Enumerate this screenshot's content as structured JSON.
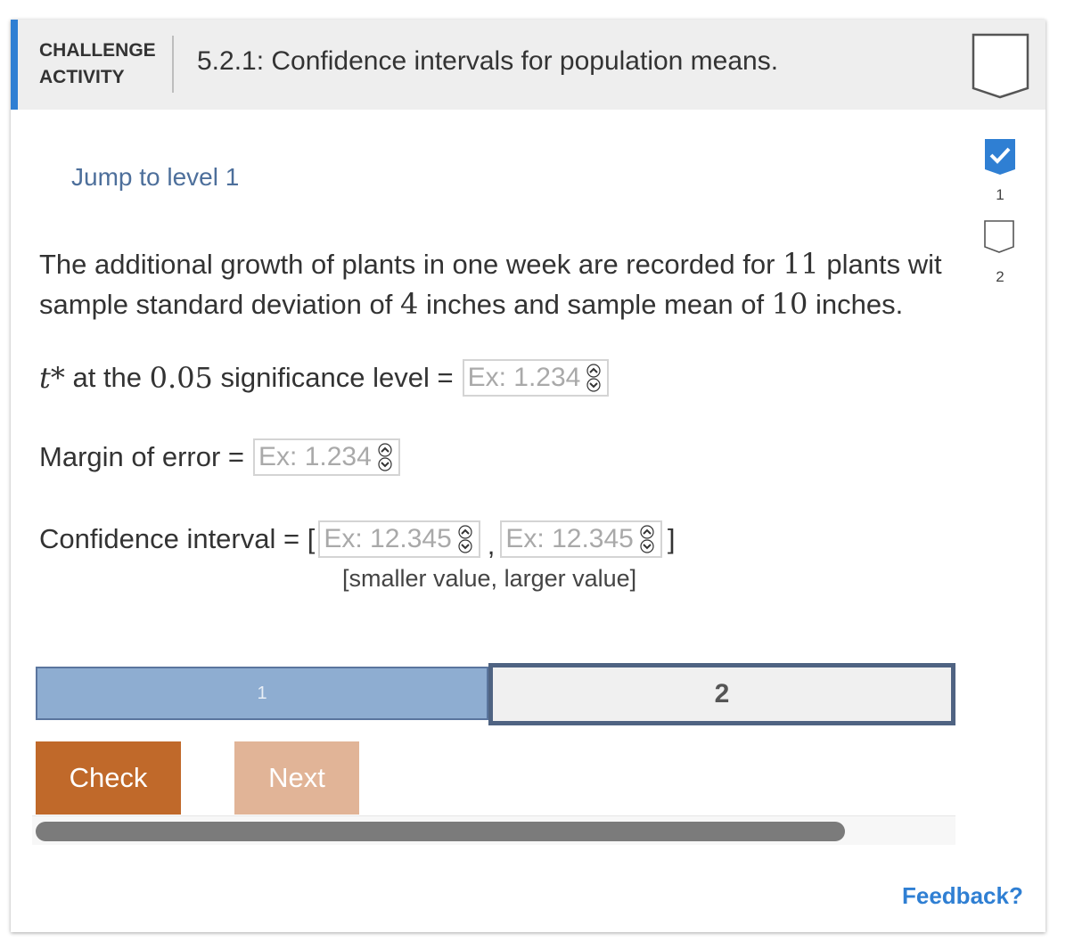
{
  "header": {
    "activity_type_line1": "CHALLENGE",
    "activity_type_line2": "ACTIVITY",
    "title": "5.2.1: Confidence intervals for population means."
  },
  "jump_link": "Jump to level 1",
  "level_nav": {
    "levels": [
      "1",
      "2"
    ],
    "completed": [
      true,
      false
    ]
  },
  "problem": {
    "part1": "The additional growth of plants in one week are recorded for ",
    "n": "11",
    "part2": " plants wit",
    "part3": "sample standard deviation of ",
    "sd": "4",
    "part4": " inches and sample mean of ",
    "mean": "10",
    "part5": " inches."
  },
  "questions": {
    "tstar_symbol": "t*",
    "tstar_mid": " at the ",
    "tstar_level": "0.05",
    "tstar_end": " significance level =",
    "tstar_placeholder": "Ex: 1.234",
    "margin_label": "Margin of error =",
    "margin_placeholder": "Ex: 1.234",
    "ci_label": "Confidence interval = [",
    "ci_lower_placeholder": "Ex: 12.345",
    "ci_comma": ",",
    "ci_upper_placeholder": "Ex: 12.345",
    "ci_close": "]",
    "ci_hint": "[smaller value, larger value]"
  },
  "progress": {
    "level1": "1",
    "level2": "2"
  },
  "buttons": {
    "check": "Check",
    "next": "Next"
  },
  "feedback": "Feedback?",
  "colors": {
    "accent": "#2f7fd3",
    "check": "#c0692a",
    "next": "#e1b497",
    "progress_done": "#8eadd1"
  }
}
